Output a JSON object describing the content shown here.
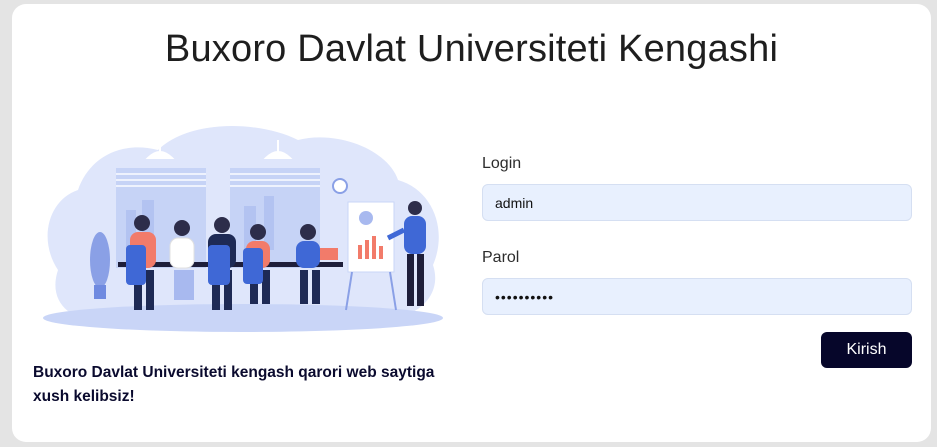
{
  "page": {
    "title": "Buxoro Davlat Universiteti Kengashi",
    "welcome_text": "Buxoro Davlat Universiteti kengash qarori web saytiga xush kelibsiz!"
  },
  "form": {
    "login_label": "Login",
    "login_value": "admin",
    "password_label": "Parol",
    "password_value": "••••••••••",
    "submit_label": "Kirish"
  },
  "colors": {
    "button_bg": "#06062a",
    "input_bg": "#e8f0fe",
    "illustration_blob": "#dfe6fb",
    "accent_blue": "#3f68d6",
    "accent_coral": "#f27b6a"
  }
}
